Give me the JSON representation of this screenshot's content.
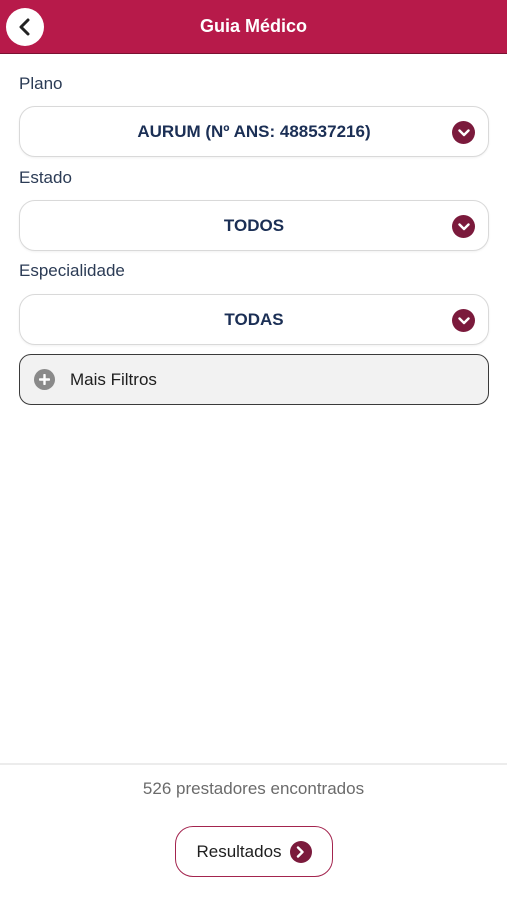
{
  "header": {
    "title": "Guia Médico",
    "back_icon": "chevron-left-icon",
    "color": "#b71a4a"
  },
  "form": {
    "plano": {
      "label": "Plano",
      "value": "AURUM (Nº ANS: 488537216)"
    },
    "estado": {
      "label": "Estado",
      "value": "TODOS"
    },
    "especialidade": {
      "label": "Especialidade",
      "value": "TODAS"
    },
    "more_filters": {
      "label": "Mais Filtros",
      "icon": "plus-circle-icon"
    },
    "dropdown_icon": "chevron-down-circle-icon",
    "accent": "#7b1a3c"
  },
  "footer": {
    "count_text": "526 prestadores encontrados",
    "results_button": {
      "label": "Resultados",
      "icon": "chevron-right-circle-icon"
    }
  }
}
